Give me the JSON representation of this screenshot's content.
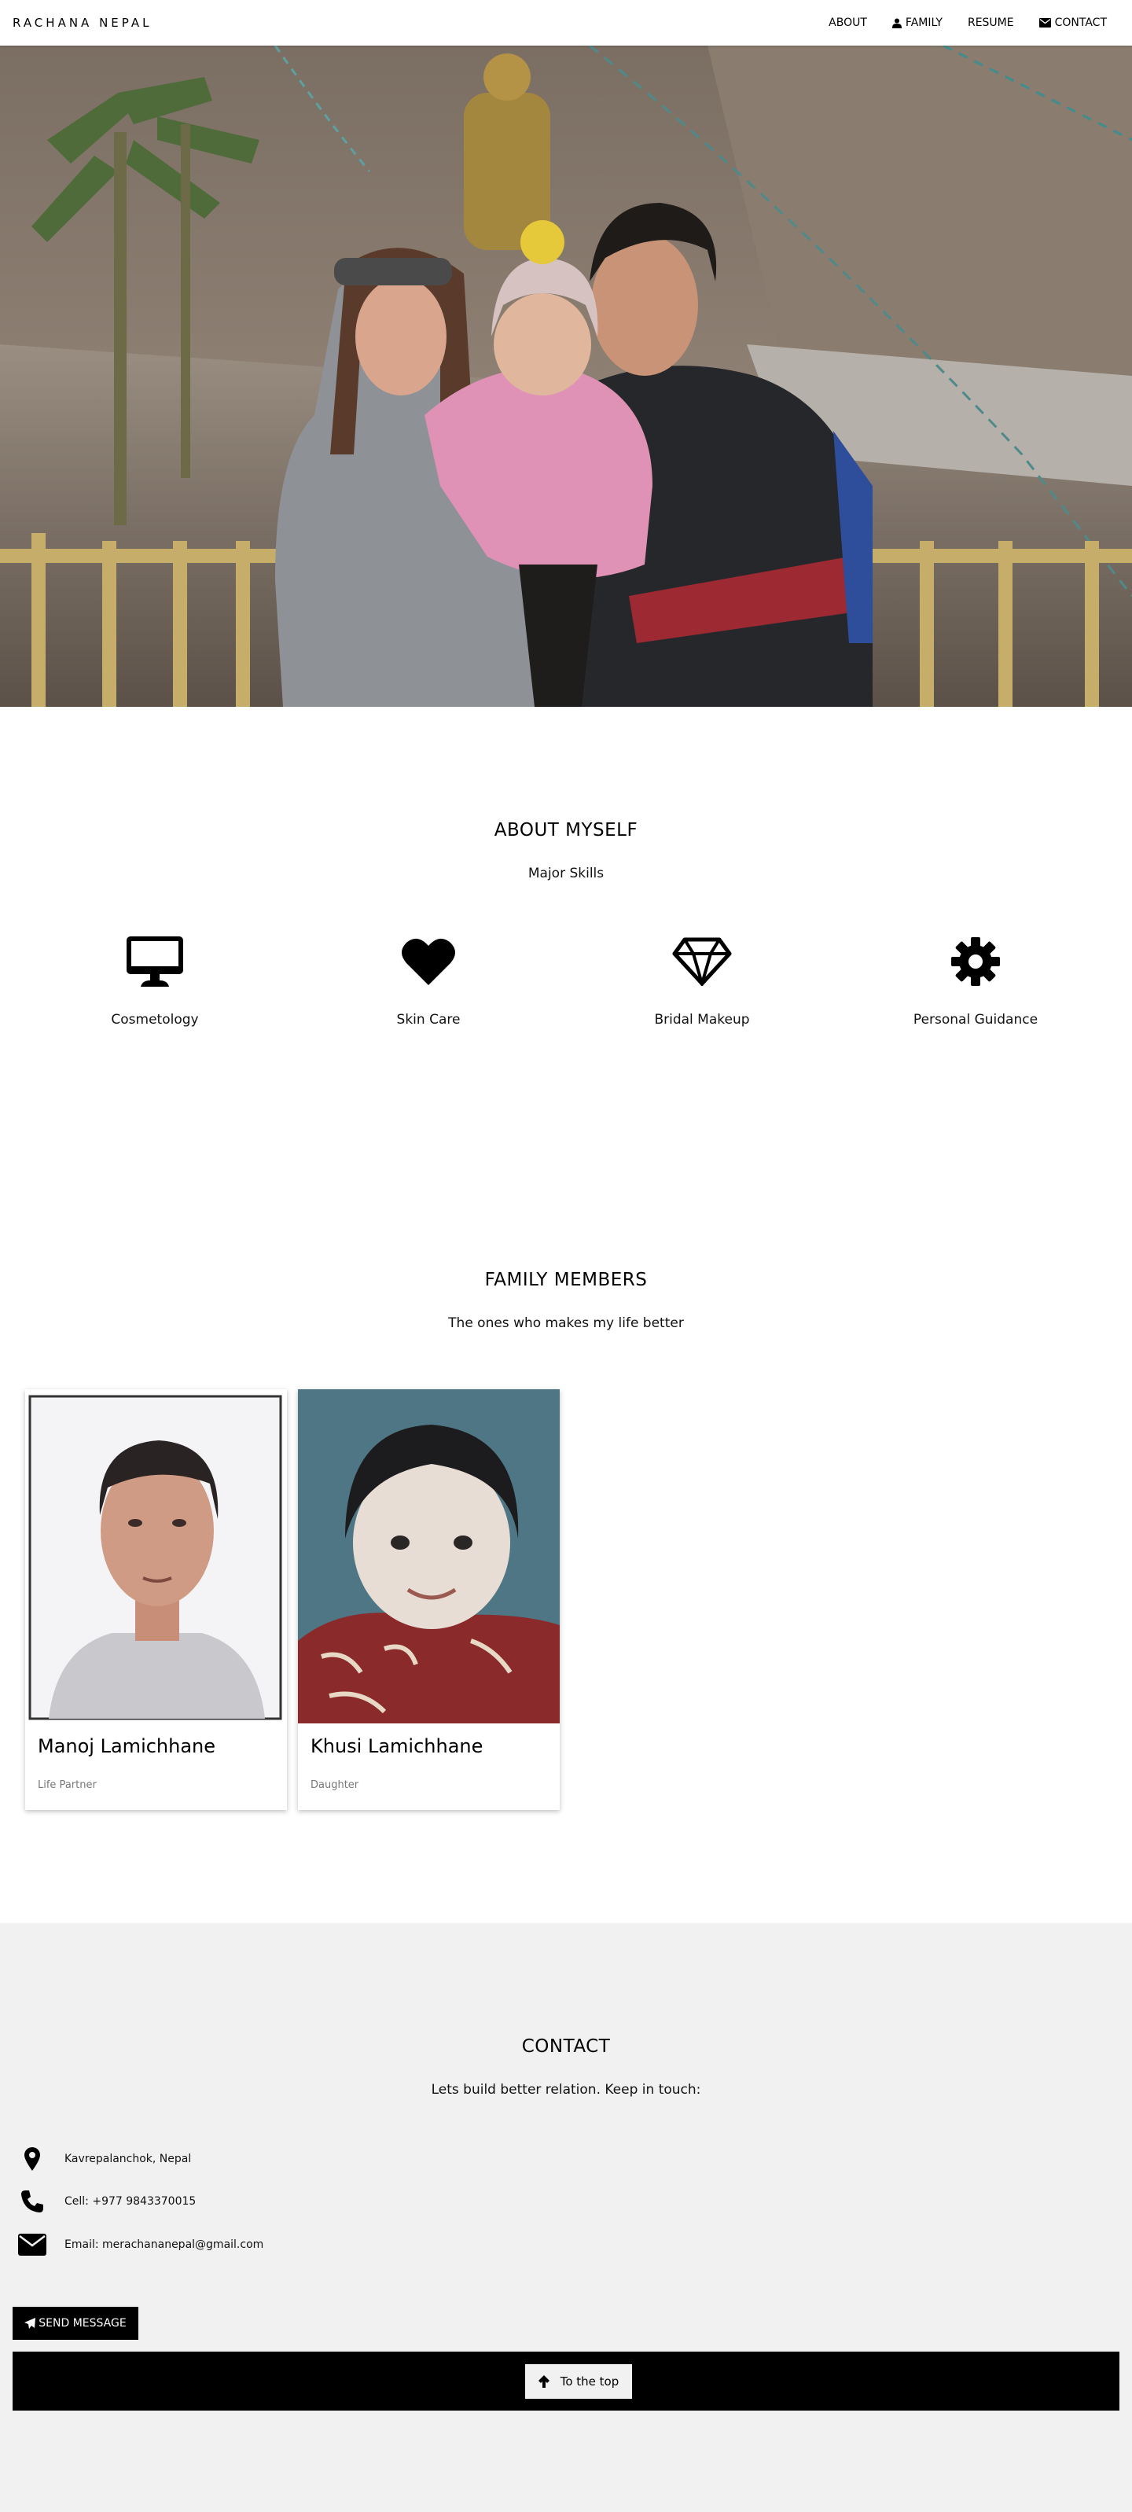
{
  "nav": {
    "brand": "RACHANA NEPAL",
    "links": [
      "ABOUT",
      "FAMILY",
      "RESUME",
      "CONTACT"
    ],
    "icons": [
      "user-icon",
      "envelope-icon"
    ]
  },
  "about": {
    "title": "ABOUT MYSELF",
    "subtitle": "Major Skills",
    "skills": [
      {
        "label": "Cosmetology",
        "icon": "desktop-icon"
      },
      {
        "label": "Skin Care",
        "icon": "heart-icon"
      },
      {
        "label": "Bridal Makeup",
        "icon": "diamond-icon"
      },
      {
        "label": "Personal Guidance",
        "icon": "cog-icon"
      }
    ]
  },
  "family": {
    "title": "FAMILY MEMBERS",
    "subtitle": "The ones who makes my life better",
    "members": [
      {
        "name": "Manoj Lamichhane",
        "role": "Life Partner"
      },
      {
        "name": "Khusi Lamichhane",
        "role": "Daughter"
      }
    ]
  },
  "contact": {
    "title": "CONTACT",
    "subtitle": "Lets build better relation. Keep in touch:",
    "address": "Kavrepalanchok, Nepal",
    "phone": "Cell: +977 9843370015",
    "email": "Email: merachananepal@gmail.com",
    "send_label": "SEND MESSAGE",
    "top_label": "To the top"
  },
  "colors": {
    "footer": "#000000",
    "contact_bg": "#f1f1f1",
    "text": "#000000"
  }
}
